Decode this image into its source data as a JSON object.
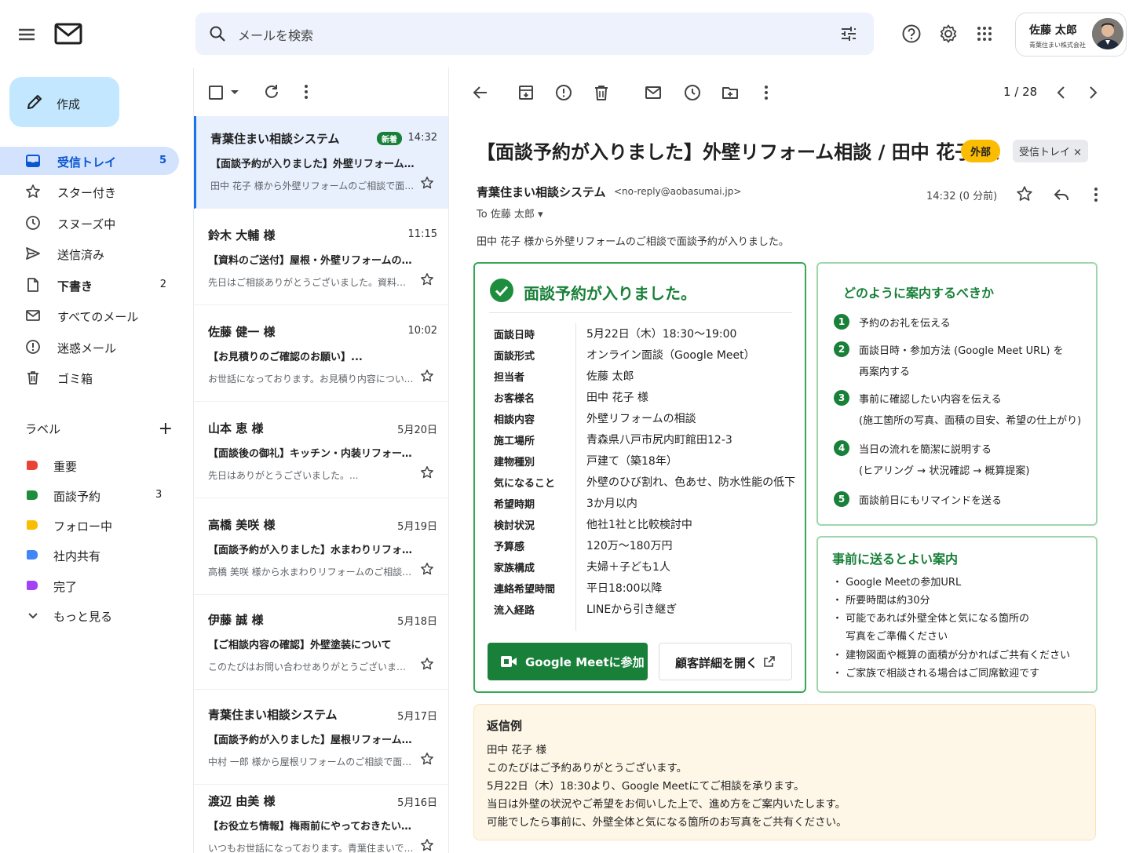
{
  "topbar": {
    "search_placeholder": "メールを検索",
    "account_name": "佐藤 太郎",
    "account_company": "青葉住まい株式会社"
  },
  "sidebar": {
    "compose_label": "作成",
    "nav": [
      {
        "label": "受信トレイ",
        "count": "5"
      },
      {
        "label": "スター付き",
        "count": ""
      },
      {
        "label": "スヌーズ中",
        "count": ""
      },
      {
        "label": "送信済み",
        "count": ""
      },
      {
        "label": "下書き",
        "count": "2"
      },
      {
        "label": "すべてのメール",
        "count": ""
      },
      {
        "label": "迷惑メール",
        "count": ""
      },
      {
        "label": "ゴミ箱",
        "count": ""
      }
    ],
    "labels_heading": "ラベル",
    "labels": [
      {
        "label": "重要",
        "count": "",
        "color": "#ea4335"
      },
      {
        "label": "面談予約",
        "count": "3",
        "color": "#1e8e3e"
      },
      {
        "label": "フォロー中",
        "count": "",
        "color": "#fbbc04"
      },
      {
        "label": "社内共有",
        "count": "",
        "color": "#4285f4"
      },
      {
        "label": "完了",
        "count": "",
        "color": "#a142f4"
      }
    ],
    "more_label": "もっと見る"
  },
  "mail_list": [
    {
      "from": "青葉住まい相談システム",
      "badge": "新着",
      "time": "14:32",
      "subject": "【面談予約が入りました】外壁リフォーム相談 / 田中 花子 様",
      "snippet": "田中 花子 様から外壁リフォームのご相談で面談予約が入りました。"
    },
    {
      "from": "鈴木 大輔 様",
      "badge": "",
      "time": "11:15",
      "subject": "【資料のご送付】屋根・外壁リフォームのご案内",
      "snippet": "先日はご相談ありがとうございました。資料をお送りいたします。"
    },
    {
      "from": "佐藤 健一 様",
      "badge": "",
      "time": "10:02",
      "subject": "【お見積りのご確認のお願い】...",
      "snippet": "お世話になっております。お見積り内容について確認させてください。"
    },
    {
      "from": "山本 恵 様",
      "badge": "",
      "time": "5月20日",
      "subject": "【面談後の御礼】キッチン・内装リフォームについて",
      "snippet": "先日はありがとうございました。..."
    },
    {
      "from": "高橋 美咲 様",
      "badge": "",
      "time": "5月19日",
      "subject": "【面談予約が入りました】水まわりリフォーム相談",
      "snippet": "高橋 美咲 様から水まわりリフォームのご相談で面談予約が入りました。"
    },
    {
      "from": "伊藤 誠 様",
      "badge": "",
      "time": "5月18日",
      "subject": "【ご相談内容の確認】外壁塗装について",
      "snippet": "このたびはお問い合わせありがとうございます。"
    },
    {
      "from": "青葉住まい相談システム",
      "badge": "",
      "time": "5月17日",
      "subject": "【面談予約が入りました】屋根リフォーム相談",
      "snippet": "中村 一郎 様から屋根リフォームのご相談で面談予約が入りました。"
    },
    {
      "from": "渡辺 由美 様",
      "badge": "",
      "time": "5月16日",
      "subject": "【お役立ち情報】梅雨前にやっておきたい住まいの点検",
      "snippet": "いつもお世話になっております。青葉住まいです。"
    }
  ],
  "reading": {
    "pager": "1 / 28",
    "subject": "【面談予約が入りました】外壁リフォーム相談 / 田中 花子 様",
    "chip_external": "外部",
    "chip_inbox": "受信トレイ ×",
    "sender_name": "青葉住まい相談システム",
    "sender_email": "<no-reply@aobasumai.jp>",
    "to": "To 佐藤 太郎 ▾",
    "time": "14:32 (0 分前)",
    "intro": "田中 花子 様から外壁リフォームのご相談で面談予約が入りました。",
    "main_card": {
      "title": "面談予約が入りました。",
      "rows": [
        {
          "k": "面談日時",
          "v": "5月22日（木）18:30〜19:00"
        },
        {
          "k": "面談形式",
          "v": "オンライン面談（Google Meet）"
        },
        {
          "k": "担当者",
          "v": "佐藤 太郎"
        },
        {
          "k": "お客様名",
          "v": "田中 花子 様"
        },
        {
          "k": "相談内容",
          "v": "外壁リフォームの相談"
        },
        {
          "k": "施工場所",
          "v": "青森県八戸市尻内町館田12-3"
        },
        {
          "k": "建物種別",
          "v": "戸建て（築18年）"
        },
        {
          "k": "気になること",
          "v": "外壁のひび割れ、色あせ、防水性能の低下"
        },
        {
          "k": "希望時期",
          "v": "3か月以内"
        },
        {
          "k": "検討状況",
          "v": "他社1社と比較検討中"
        },
        {
          "k": "予算感",
          "v": "120万〜180万円"
        },
        {
          "k": "家族構成",
          "v": "夫婦＋子ども1人"
        },
        {
          "k": "連絡希望時間",
          "v": "平日18:00以降"
        },
        {
          "k": "流入経路",
          "v": "LINEから引き継ぎ"
        }
      ],
      "meet_button": "Google Meetに参加",
      "customer_button": "顧客詳細を開く"
    },
    "how_card": {
      "title": "どのように案内するべきか",
      "steps": [
        {
          "n": "1",
          "t1": "予約のお礼を伝える",
          "t2": ""
        },
        {
          "n": "2",
          "t1": "面談日時・参加方法 (Google Meet URL) を",
          "t2": "再案内する"
        },
        {
          "n": "3",
          "t1": "事前に確認したい内容を伝える",
          "t2": "(施工箇所の写真、面積の目安、希望の仕上がり)"
        },
        {
          "n": "4",
          "t1": "当日の流れを簡潔に説明する",
          "t2": "(ヒアリング → 状況確認 → 概算提案)"
        },
        {
          "n": "5",
          "t1": "面談前日にもリマインドを送る",
          "t2": ""
        }
      ]
    },
    "pre_card": {
      "title": "事前に送るとよい案内",
      "items": [
        "・ Google Meetの参加URL",
        "・ 所要時間は約30分",
        "・ 可能であれば外壁全体と気になる箇所の",
        "　 写真をご準備ください",
        "・ 建物図面や概算の面積が分かればご共有ください",
        "・ ご家族で相談される場合はご同席歓迎です"
      ]
    },
    "reply_card": {
      "title": "返信例",
      "lines": [
        "田中 花子 様",
        "このたびはご予約ありがとうございます。",
        "5月22日（木）18:30より、Google Meetにてご相談を承ります。",
        "当日は外壁の状況やご希望をお伺いした上で、進め方をご案内いたします。",
        "可能でしたら事前に、外壁全体と気になる箇所のお写真をご共有ください。"
      ]
    }
  }
}
